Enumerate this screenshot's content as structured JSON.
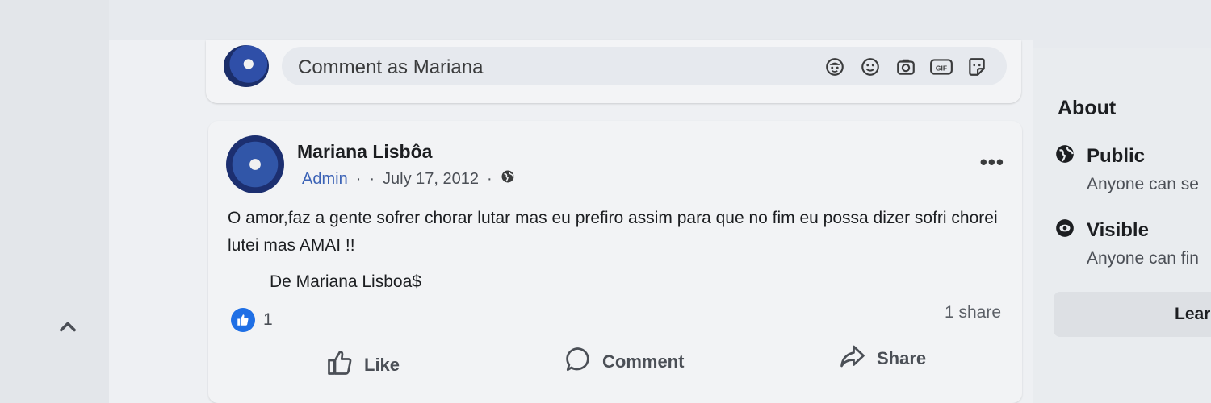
{
  "comment_bar": {
    "placeholder": "Comment as Mariana",
    "icons": [
      "avatar-sticker-icon",
      "emoji-icon",
      "camera-icon",
      "gif-icon",
      "sticker-icon"
    ],
    "icon_labels": {
      "gif": "GIF"
    }
  },
  "post": {
    "author": "Mariana Lisbôa",
    "role": "Admin",
    "separator": "·",
    "date": "July 17, 2012",
    "privacy_icon": "globe-icon",
    "text": "O amor,faz a gente sofrer chorar lutar mas eu prefiro assim para que no fim eu possa dizer sofri chorei lutei mas AMAI !!",
    "signature": "De Mariana Lisboa$",
    "reaction_count": "1",
    "share_count": "1 share",
    "actions": {
      "like": "Like",
      "comment": "Comment",
      "share": "Share"
    }
  },
  "about": {
    "title": "About",
    "public_label": "Public",
    "public_desc": "Anyone can se",
    "visible_label": "Visible",
    "visible_desc": "Anyone can fin",
    "learn_more": "Lear"
  },
  "colors": {
    "accent": "#1f6fe5",
    "admin": "#3b62b6"
  }
}
